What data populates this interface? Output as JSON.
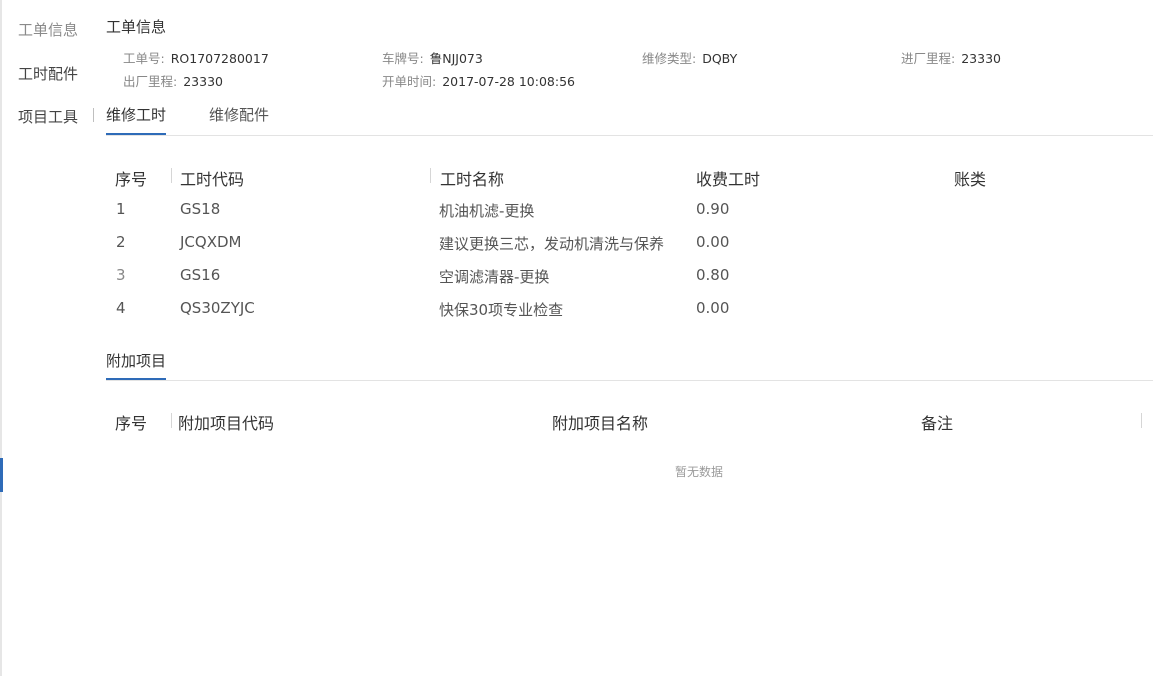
{
  "sidenav": {
    "items": [
      {
        "label": "工单信息"
      },
      {
        "label": "工时配件"
      },
      {
        "label": "项目工具"
      }
    ]
  },
  "header": {
    "title": "工单信息",
    "fields": [
      {
        "label": "工单号:",
        "value": "RO1707280017"
      },
      {
        "label": "车牌号:",
        "value": "鲁NJJ073"
      },
      {
        "label": "维修类型:",
        "value": "DQBY"
      },
      {
        "label": "进厂里程:",
        "value": "23330"
      },
      {
        "label": "出厂里程:",
        "value": "23330"
      },
      {
        "label": "开单时间:",
        "value": "2017-07-28 10:08:56"
      }
    ]
  },
  "tabs": [
    {
      "label": "维修工时",
      "active": true
    },
    {
      "label": "维修配件",
      "active": false
    }
  ],
  "labor_table": {
    "columns": [
      "序号",
      "工时代码",
      "工时名称",
      "收费工时",
      "账类"
    ],
    "rows": [
      {
        "seq": "1",
        "code": "GS18",
        "name": "机油机滤-更换",
        "hours": "0.90",
        "account": ""
      },
      {
        "seq": "2",
        "code": "JCQXDM",
        "name": "建议更换三芯，发动机清洗与保养",
        "hours": "0.00",
        "account": ""
      },
      {
        "seq": "3",
        "code": "GS16",
        "name": "空调滤清器-更换",
        "hours": "0.80",
        "account": ""
      },
      {
        "seq": "4",
        "code": "QS30ZYJC",
        "name": "快保30项专业检查",
        "hours": "0.00",
        "account": ""
      }
    ]
  },
  "extra_items": {
    "title": "附加项目",
    "columns": [
      "序号",
      "附加项目代码",
      "附加项目名称",
      "备注"
    ],
    "empty_text": "暂无数据"
  },
  "colors": {
    "accent": "#2e6bb8",
    "divider": "#e3e3e3"
  }
}
